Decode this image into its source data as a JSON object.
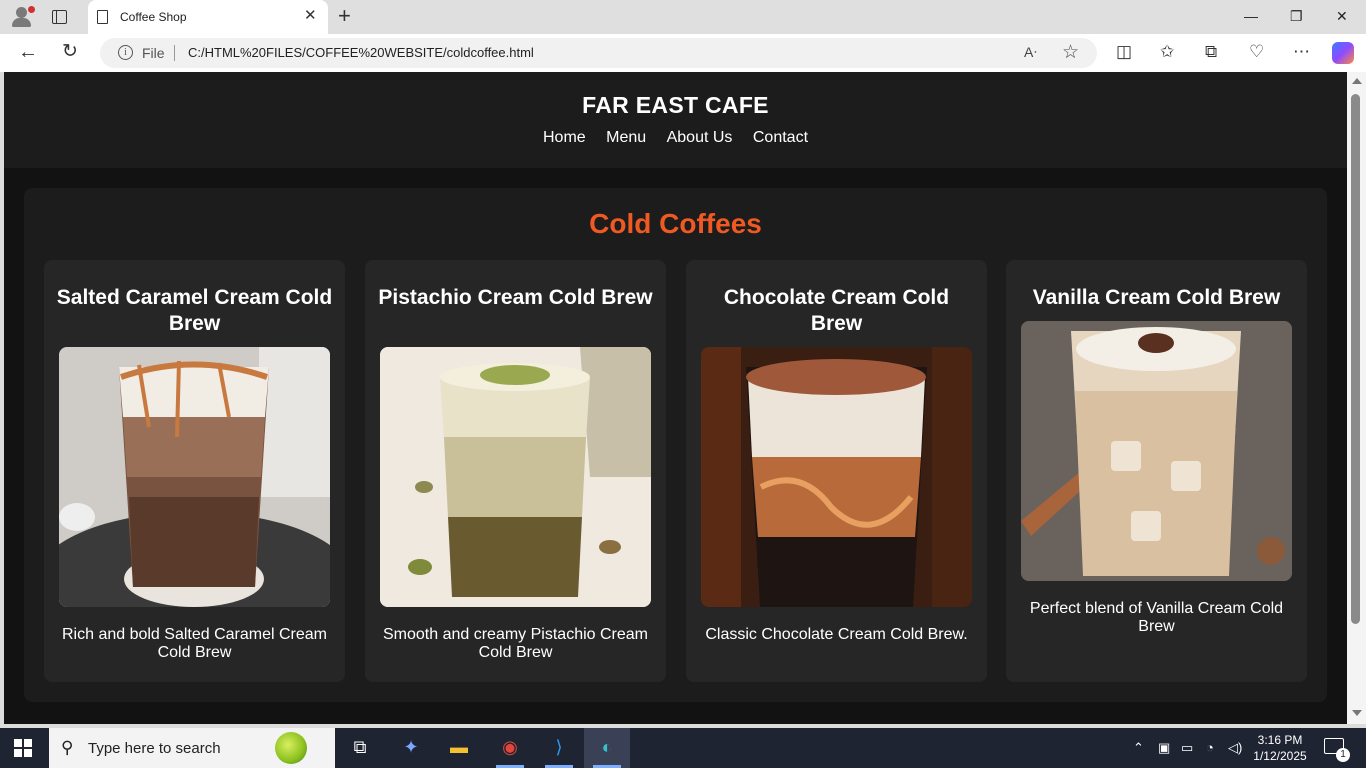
{
  "browser": {
    "tab_title": "Coffee Shop",
    "tab_close": "✕",
    "new_tab": "+",
    "address_label": "File",
    "url": "C:/HTML%20FILES/COFFEE%20WEBSITE/coldcoffee.html",
    "window_controls": {
      "minimize": "—",
      "restore": "❐",
      "close": "✕"
    }
  },
  "site": {
    "title": "FAR EAST CAFE",
    "nav": [
      "Home",
      "Menu",
      "About Us",
      "Contact"
    ]
  },
  "section": {
    "title": "Cold Coffees",
    "products": [
      {
        "name": "Salted Caramel Cream Cold Brew",
        "description": "Rich and bold Salted Caramel Cream Cold Brew"
      },
      {
        "name": "Pistachio Cream Cold Brew",
        "description": "Smooth and creamy Pistachio Cream Cold Brew"
      },
      {
        "name": "Chocolate Cream Cold Brew",
        "description": "Classic Chocolate Cream Cold Brew."
      },
      {
        "name": "Vanilla Cream Cold Brew",
        "description": "Perfect blend of Vanilla Cream Cold Brew"
      }
    ]
  },
  "taskbar": {
    "search_placeholder": "Type here to search",
    "time": "3:16 PM",
    "date": "1/12/2025",
    "notification_count": "1"
  },
  "colors": {
    "accent": "#f05a22",
    "page_bg": "#121212",
    "card_bg": "#262626"
  },
  "icons": [
    "profile-icon",
    "tab-actions-icon",
    "page-icon",
    "back-icon",
    "refresh-icon",
    "info-icon",
    "read-aloud-icon",
    "favorite-star-icon",
    "split-screen-icon",
    "favorites-icon",
    "collections-icon",
    "browser-essentials-icon",
    "more-icon",
    "copilot-icon",
    "windows-start-icon",
    "search-icon",
    "task-view-icon",
    "file-explorer-icon",
    "chrome-icon",
    "vscode-icon",
    "edge-icon",
    "wifi-icon",
    "volume-icon",
    "battery-icon",
    "notification-icon"
  ]
}
